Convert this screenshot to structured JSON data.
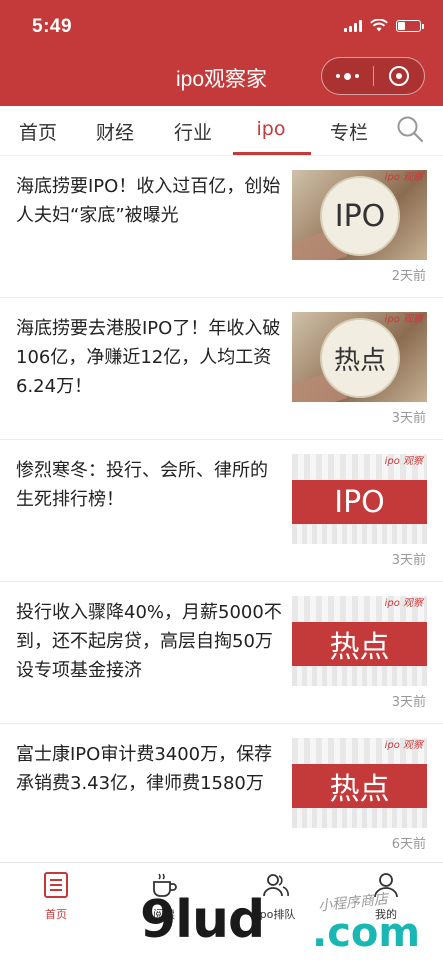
{
  "status_bar": {
    "time": "5:49"
  },
  "header": {
    "title": "ipo观察家",
    "capsule": {
      "more": "more-icon",
      "close": "target-icon"
    }
  },
  "tabs": [
    {
      "label": "首页"
    },
    {
      "label": "财经"
    },
    {
      "label": "行业"
    },
    {
      "label": "ipo",
      "active": true
    },
    {
      "label": "专栏"
    }
  ],
  "articles": [
    {
      "title": "海底捞要IPO！收入过百亿，创始人夫妇“家底”被曝光",
      "thumb_text": "IPO",
      "thumb_brand": "ipo 观察",
      "ago": "2天前",
      "style": "photo"
    },
    {
      "title": "海底捞要去港股IPO了！年收入破106亿，净赚近12亿，人均工资6.24万！",
      "thumb_text": "热点",
      "thumb_brand": "ipo 观察",
      "ago": "3天前",
      "style": "photo"
    },
    {
      "title": "惨烈寒冬：投行、会所、律所的生死排行榜！",
      "thumb_text": "IPO",
      "thumb_brand": "ipo 观察",
      "ago": "3天前",
      "style": "red"
    },
    {
      "title": "投行收入骤降40%，月薪5000不到，还不起房贷，高层自掏50万设专项基金接济",
      "thumb_text": "热点",
      "thumb_brand": "ipo 观察",
      "ago": "3天前",
      "style": "red"
    },
    {
      "title": "富士康IPO审计费3400万，保荐承销费3.43亿，律师费1580万",
      "thumb_text": "热点",
      "thumb_brand": "ipo 观察",
      "ago": "6天前",
      "style": "red"
    }
  ],
  "bottom_nav": [
    {
      "label": "首页",
      "icon": "home-list-icon",
      "active": true
    },
    {
      "label": "阅读",
      "icon": "coffee-icon"
    },
    {
      "label": "ipo排队",
      "icon": "people-icon"
    },
    {
      "label": "我的",
      "icon": "person-icon"
    }
  ],
  "watermark": {
    "text": "9lud",
    "suffix": ".com",
    "script": "小程序商店"
  },
  "colors": {
    "brand_red": "#c43a3a",
    "watermark_teal": "#19b7b3"
  }
}
